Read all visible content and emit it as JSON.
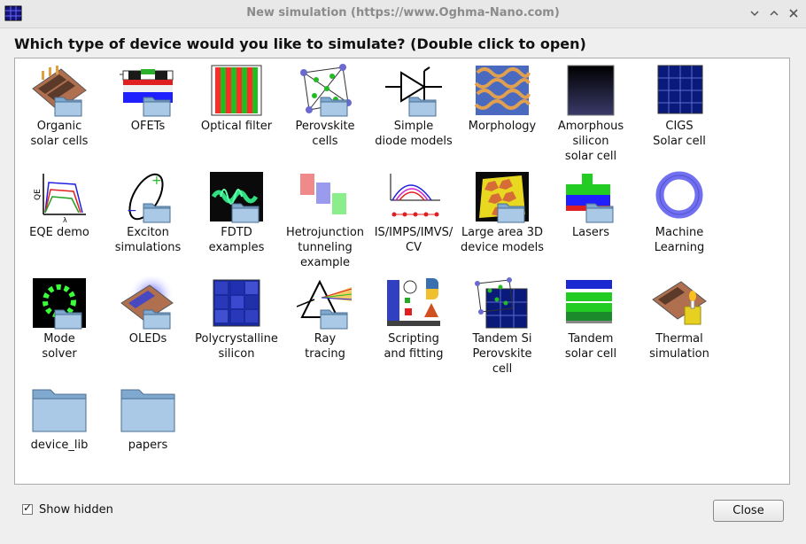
{
  "window": {
    "title": "New simulation (https://www.Oghma-Nano.com)"
  },
  "heading": "Which type of device would you like to simulate? (Double click to open)",
  "items": [
    {
      "label": "Organic\nsolar cells",
      "icon": "organic-solar-cell-icon"
    },
    {
      "label": "OFETs",
      "icon": "ofet-icon"
    },
    {
      "label": "Optical filter",
      "icon": "optical-filter-icon"
    },
    {
      "label": "Perovskite\ncells",
      "icon": "perovskite-icon"
    },
    {
      "label": "Simple\ndiode models",
      "icon": "diode-icon"
    },
    {
      "label": "Morphology",
      "icon": "morphology-icon"
    },
    {
      "label": "Amorphous\nsilicon\nsolar cell",
      "icon": "amorphous-silicon-icon"
    },
    {
      "label": "CIGS\nSolar cell",
      "icon": "cigs-icon"
    },
    {
      "label": "EQE demo",
      "icon": "eqe-icon"
    },
    {
      "label": "Exciton\nsimulations",
      "icon": "exciton-icon"
    },
    {
      "label": "FDTD\nexamples",
      "icon": "fdtd-icon"
    },
    {
      "label": "Hetrojunction\ntunneling\nexample",
      "icon": "heterojunction-icon"
    },
    {
      "label": "IS/IMPS/IMVS/\nCV",
      "icon": "impedance-icon"
    },
    {
      "label": "Large area 3D\ndevice models",
      "icon": "large-area-3d-icon"
    },
    {
      "label": "Lasers",
      "icon": "laser-icon"
    },
    {
      "label": "Machine\nLearning",
      "icon": "machine-learning-icon"
    },
    {
      "label": "Mode\nsolver",
      "icon": "mode-solver-icon"
    },
    {
      "label": "OLEDs",
      "icon": "oled-icon"
    },
    {
      "label": "Polycrystalline\nsilicon",
      "icon": "polycrystalline-icon"
    },
    {
      "label": "Ray\ntracing",
      "icon": "ray-tracing-icon"
    },
    {
      "label": "Scripting\nand fitting",
      "icon": "scripting-icon"
    },
    {
      "label": "Tandem Si\nPerovskite\ncell",
      "icon": "tandem-si-perovskite-icon"
    },
    {
      "label": "Tandem\nsolar cell",
      "icon": "tandem-solar-icon"
    },
    {
      "label": "Thermal\nsimulation",
      "icon": "thermal-icon"
    },
    {
      "label": "device_lib",
      "icon": "folder-icon"
    },
    {
      "label": "papers",
      "icon": "folder-icon"
    }
  ],
  "footer": {
    "show_hidden_label": "Show hidden",
    "show_hidden_checked": true,
    "check_mark": "✓",
    "close_label": "Close"
  }
}
